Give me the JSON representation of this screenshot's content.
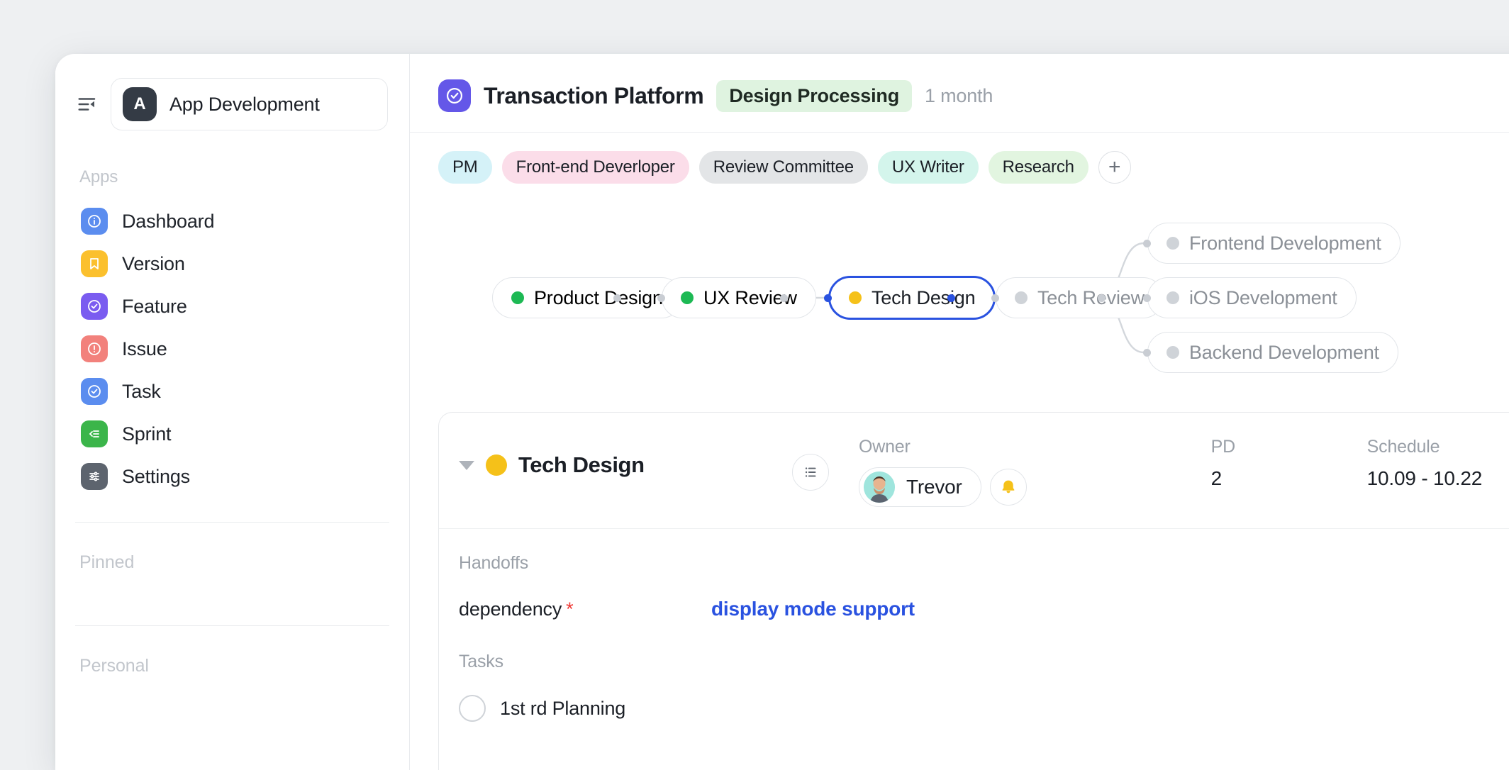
{
  "sidebar": {
    "collapse_icon": "sidebar-collapse-icon",
    "workspace": {
      "initial": "A",
      "name": "App Development"
    },
    "apps_label": "Apps",
    "items": [
      {
        "label": "Dashboard",
        "icon": "info-circle-icon",
        "color": "#5b8def"
      },
      {
        "label": "Version",
        "icon": "bookmark-icon",
        "color": "#fbc02d"
      },
      {
        "label": "Feature",
        "icon": "check-circle-icon",
        "color": "#7a5cf0"
      },
      {
        "label": "Issue",
        "icon": "alert-circle-icon",
        "color": "#f2817c"
      },
      {
        "label": "Task",
        "icon": "check-circle-icon",
        "color": "#5b8def"
      },
      {
        "label": "Sprint",
        "icon": "sprint-list-icon",
        "color": "#3bb54a"
      },
      {
        "label": "Settings",
        "icon": "sliders-icon",
        "color": "#5d646e"
      }
    ],
    "pinned_label": "Pinned",
    "personal_label": "Personal"
  },
  "header": {
    "project_icon": "check-circle-icon",
    "project_icon_color": "#6457e8",
    "title": "Transaction Platform",
    "status": "Design Processing",
    "status_color": "#dff3e0",
    "duration": "1 month"
  },
  "tags": {
    "items": [
      {
        "label": "PM",
        "bg": "#d5f2f8"
      },
      {
        "label": "Front-end Deverloper",
        "bg": "#fbdde9"
      },
      {
        "label": "Review Committee",
        "bg": "#e3e5e7"
      },
      {
        "label": "UX Writer",
        "bg": "#d4f5ec"
      },
      {
        "label": "Research",
        "bg": "#e2f5e0"
      }
    ],
    "add_label": "+"
  },
  "flow": {
    "nodes": [
      {
        "id": "product-design",
        "label": "Product Design",
        "dot": "#1db954",
        "state": "done"
      },
      {
        "id": "ux-review",
        "label": "UX Review",
        "dot": "#1db954",
        "state": "done"
      },
      {
        "id": "tech-design",
        "label": "Tech Design",
        "dot": "#f5c119",
        "state": "active"
      },
      {
        "id": "tech-review",
        "label": "Tech Review",
        "dot": "#cfd3d8",
        "state": "pending"
      },
      {
        "id": "frontend-dev",
        "label": "Frontend Development",
        "dot": "#cfd3d8",
        "state": "pending"
      },
      {
        "id": "ios-dev",
        "label": "iOS Development",
        "dot": "#cfd3d8",
        "state": "pending"
      },
      {
        "id": "backend-dev",
        "label": "Backend Development",
        "dot": "#cfd3d8",
        "state": "pending"
      }
    ]
  },
  "detail": {
    "title": "Tech Design",
    "dot_color": "#f5c119",
    "list_icon": "list-view-icon",
    "owner_label": "Owner",
    "owner_name": "Trevor",
    "bell_icon": "bell-icon",
    "pd_label": "PD",
    "pd_value": "2",
    "schedule_label": "Schedule",
    "schedule_value": "10.09 - 10.22",
    "handoffs_label": "Handoffs",
    "dependency_label": "dependency",
    "dependency_required": "*",
    "dependency_value": "display mode support",
    "tasks_label": "Tasks",
    "tasks": [
      {
        "label": "1st rd Planning",
        "done": false
      }
    ]
  }
}
